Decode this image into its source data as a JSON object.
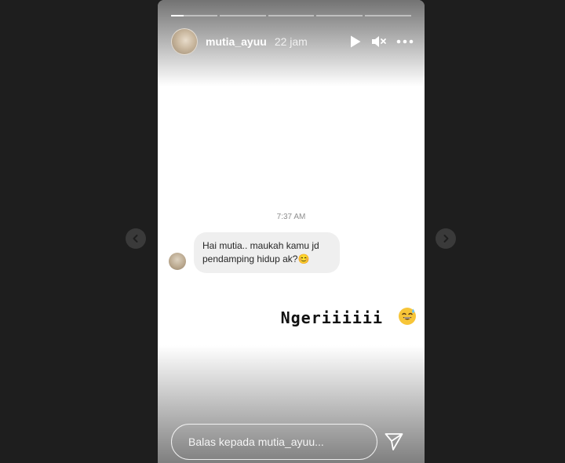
{
  "story": {
    "username": "mutia_ayuu",
    "time_ago": "22 jam",
    "segments_total": 5,
    "active_segment_progress": 0.28
  },
  "chat": {
    "timestamp": "7:37 AM",
    "message": "Hai mutia.. maukah kamu jd pendamping hidup ak?",
    "message_emoji": "😊"
  },
  "caption": {
    "text": "Ngeriiiiii",
    "emoji": "😅"
  },
  "reply": {
    "placeholder": "Balas kepada mutia_ayuu..."
  },
  "icons": {
    "play": "play-icon",
    "mute": "mute-icon",
    "more": "more-icon",
    "send": "send-icon",
    "prev": "chevron-left-icon",
    "next": "chevron-right-icon"
  },
  "colors": {
    "background": "#1e1e1e",
    "story_bg": "#ffffff",
    "bubble_bg": "#efefef"
  }
}
